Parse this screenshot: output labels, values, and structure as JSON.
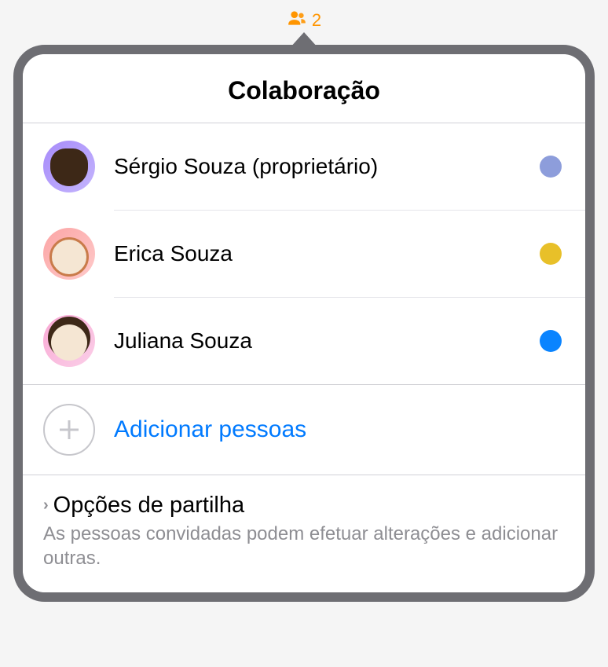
{
  "indicator": {
    "count": "2"
  },
  "header": {
    "title": "Colaboração"
  },
  "participants": [
    {
      "name": "Sérgio Souza (proprietário)",
      "color": "#8d9ddb",
      "avatarClass": "avatar-1"
    },
    {
      "name": "Erica Souza",
      "color": "#e8c029",
      "avatarClass": "avatar-2"
    },
    {
      "name": "Juliana Souza",
      "color": "#0a84ff",
      "avatarClass": "avatar-3"
    }
  ],
  "addPeople": {
    "label": "Adicionar pessoas"
  },
  "shareOptions": {
    "title": "Opções de partilha",
    "description": "As pessoas convidadas podem efetuar alterações e adicionar outras."
  }
}
